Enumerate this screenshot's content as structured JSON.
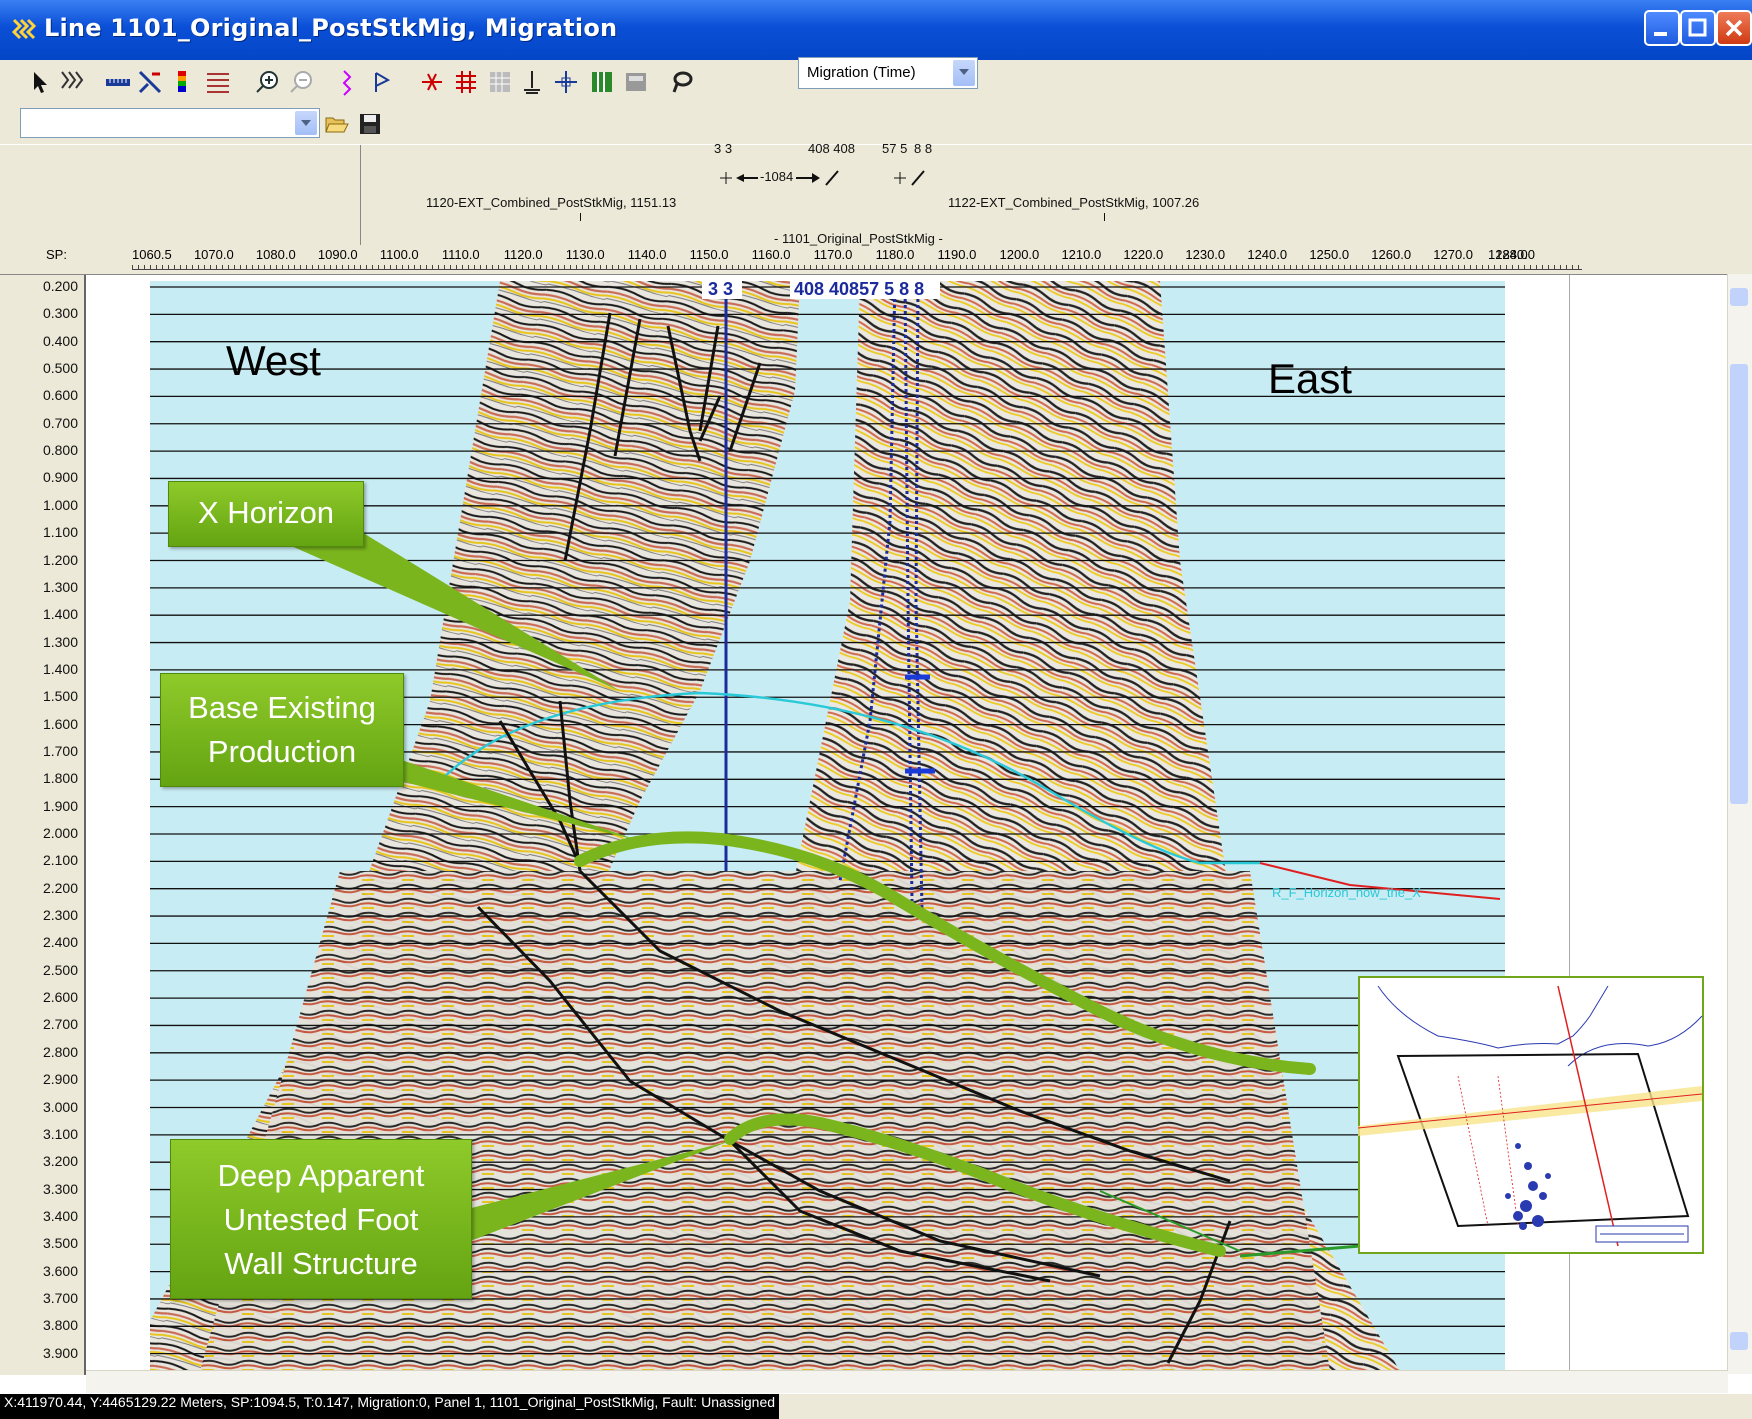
{
  "window": {
    "title": "Line 1101_Original_PostStkMig, Migration"
  },
  "toolbar": {
    "mode_select": "Migration (Time)",
    "icons": [
      "pointer-icon",
      "wiggle-icon",
      "ruler-icon",
      "fault-pick-icon",
      "color-bar-icon",
      "density-icon",
      "zoom-in-icon",
      "zoom-out-icon",
      "horizon-icon",
      "flag-icon",
      "tie-icon",
      "grid-icon",
      "mesh-icon",
      "well-icon",
      "crosshair-icon",
      "panel-icon",
      "layer-icon",
      "lasso-icon"
    ]
  },
  "toolbar2": {
    "combo_value": "",
    "icons": [
      "open-folder-icon",
      "save-icon"
    ]
  },
  "header": {
    "well_labels_top": [
      "3 3",
      "408 408",
      "57 5",
      "8 8"
    ],
    "well_arrow_text": "-1084",
    "left_line": "1120-EXT_Combined_PostStkMig, 1151.13",
    "right_line": "1122-EXT_Combined_PostStkMig, 1007.26",
    "current_line": "- 1101_Original_PostStkMig -",
    "sp_label": "SP:",
    "sp_ticks": [
      "1060.5",
      "1070.0",
      "1080.0",
      "1090.0",
      "1100.0",
      "1110.0",
      "1120.0",
      "1130.0",
      "1140.0",
      "1150.0",
      "1160.0",
      "1170.0",
      "1180.0",
      "1190.0",
      "1200.0",
      "1210.0",
      "1220.0",
      "1230.0",
      "1240.0",
      "1250.0",
      "1260.0",
      "1270.0",
      "1280.0",
      "1284.0"
    ]
  },
  "time_axis": [
    "0.200",
    "0.300",
    "0.400",
    "0.500",
    "0.600",
    "0.700",
    "0.800",
    "0.900",
    "1.000",
    "1.100",
    "1.200",
    "1.300",
    "1.400",
    "1.300",
    "1.400",
    "1.500",
    "1.600",
    "1.700",
    "1.800",
    "1.900",
    "2.000",
    "2.100",
    "2.200",
    "2.300",
    "2.400",
    "2.500",
    "2.600",
    "2.700",
    "2.800",
    "2.900",
    "3.000",
    "3.100",
    "3.200",
    "3.300",
    "3.400",
    "3.500",
    "3.600",
    "3.700",
    "3.800",
    "3.900"
  ],
  "plot": {
    "well_marker_left": "3 3",
    "well_marker_right": "408 40857 5 8 8",
    "west_label": "West",
    "east_label": "East",
    "horizon_label": "R_F_Horizon_now_the_X",
    "callouts": {
      "x_horizon": "X Horizon",
      "base_existing": [
        "Base Existing",
        "Production"
      ],
      "deep_apparent": [
        "Deep Apparent",
        "Untested Foot",
        "Wall Structure"
      ]
    },
    "colors": {
      "seismic_bg": "#c8ecf3",
      "horizon_cyan": "#29c9d8",
      "callout_green": "#7ab51d",
      "well_blue": "#1b2b9c"
    }
  },
  "status": {
    "text": "X:411970.44,  Y:4465129.22 Meters,   SP:1094.5,   T:0.147,  Migration:0,  Panel 1,  1101_Original_PostStkMig,  Fault: Unassigned"
  }
}
